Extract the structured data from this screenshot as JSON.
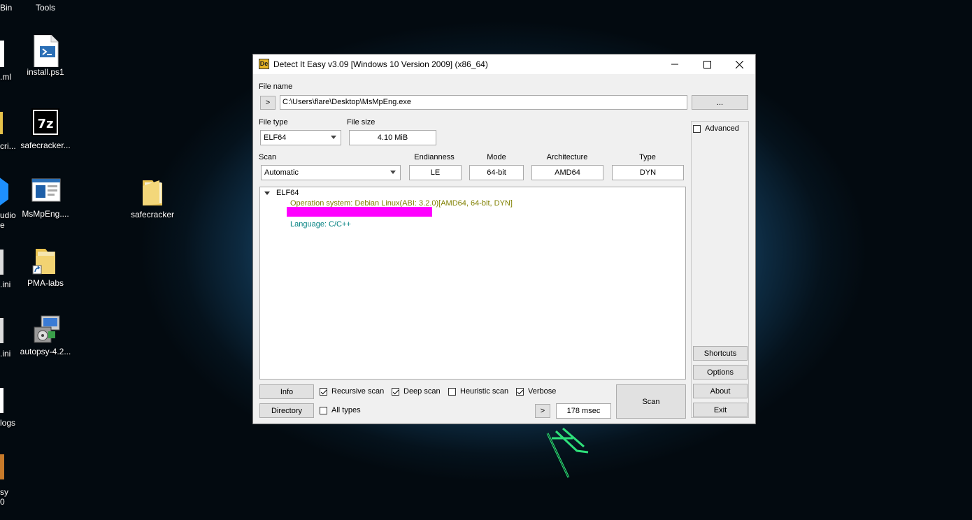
{
  "desktop": {
    "top_labels": [
      "Bin",
      "Tools"
    ],
    "icons": [
      {
        "label": "install.ps1"
      },
      {
        "label": "safecracker..."
      },
      {
        "label": "MsMpEng...."
      },
      {
        "label": "PMA-labs"
      },
      {
        "label": "autopsy-4.2..."
      },
      {
        "label": "safecracker"
      }
    ],
    "edge_labels": [
      ".ml",
      "cri...",
      "udio",
      "e",
      ".ini",
      ".ini",
      "logs",
      "sy",
      "0"
    ]
  },
  "window": {
    "title": "Detect It Easy v3.09 [Windows 10 Version 2009] (x86_64)",
    "app_icon_text": "De",
    "file_name_label": "File name",
    "file_path": "C:\\Users\\flare\\Desktop\\MsMpEng.exe",
    "path_arrow": ">",
    "browse_label": "...",
    "file_type_label": "File type",
    "file_type_value": "ELF64",
    "file_size_label": "File size",
    "file_size_value": "4.10 MiB",
    "advanced_label": "Advanced",
    "scan_label": "Scan",
    "scan_value": "Automatic",
    "endianness_label": "Endianness",
    "endianness_value": "LE",
    "mode_label": "Mode",
    "mode_value": "64-bit",
    "architecture_label": "Architecture",
    "architecture_value": "AMD64",
    "type_label": "Type",
    "type_value": "DYN",
    "tree": {
      "root": "ELF64",
      "os_line": "Operation system: Debian Linux(ABI: 3.2.0)[AMD64, 64-bit, DYN]",
      "language_line": "Language: C/C++"
    },
    "side_buttons": [
      "Shortcuts",
      "Options",
      "About",
      "Exit"
    ],
    "info_label": "Info",
    "directory_label": "Directory",
    "recursive_scan_label": "Recursive scan",
    "deep_scan_label": "Deep scan",
    "heuristic_scan_label": "Heuristic scan",
    "verbose_label": "Verbose",
    "all_types_label": "All types",
    "log_arrow": ">",
    "time_value": "178 msec",
    "scan_button_label": "Scan",
    "colors": {
      "os_line": "#808000",
      "language_line": "#008080",
      "redaction": "#ff00ff"
    }
  }
}
